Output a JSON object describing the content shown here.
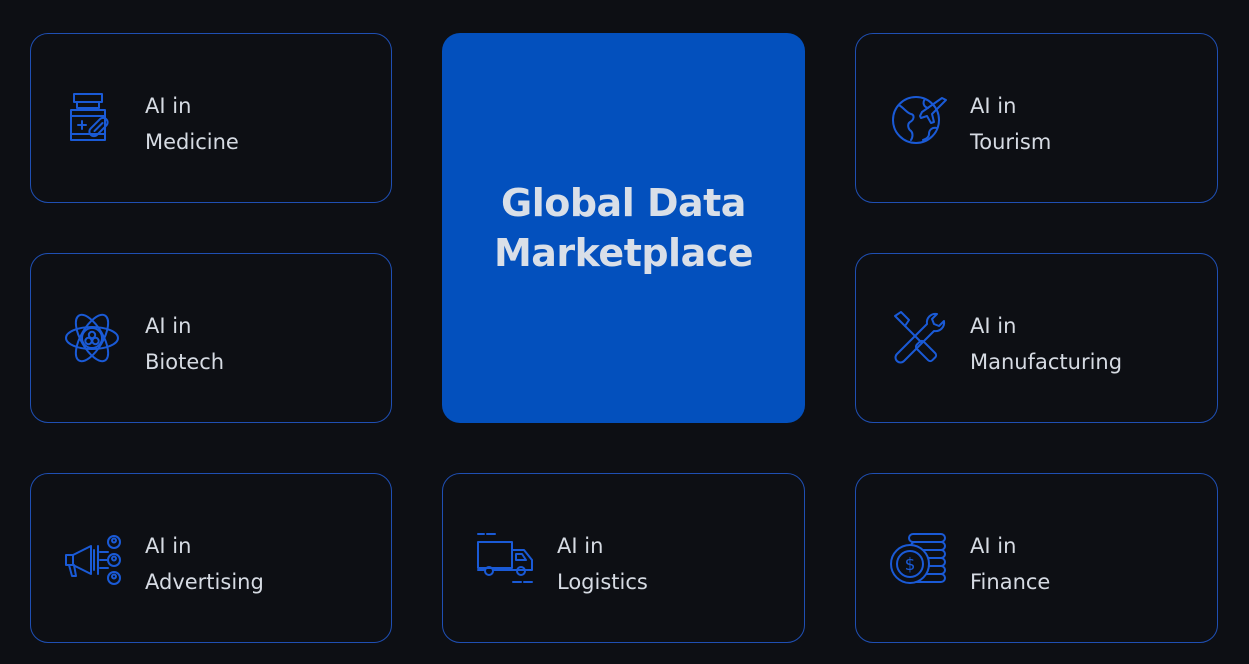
{
  "center": {
    "title_line1": "Global Data",
    "title_line2": "Marketplace",
    "color": "#0350bd"
  },
  "colors": {
    "background": "#0d0f14",
    "card_border": "#1f4fb3",
    "icon_stroke": "#1a5ad6",
    "text": "#d6dbe3"
  },
  "cards": [
    {
      "prefix": "AI in",
      "name": "Medicine",
      "icon": "medicine-icon"
    },
    {
      "prefix": "AI in",
      "name": "Tourism",
      "icon": "globe-plane-icon"
    },
    {
      "prefix": "AI in",
      "name": "Biotech",
      "icon": "atom-icon"
    },
    {
      "prefix": "AI in",
      "name": "Manufacturing",
      "icon": "tools-icon"
    },
    {
      "prefix": "AI in",
      "name": "Advertising",
      "icon": "megaphone-icon"
    },
    {
      "prefix": "AI in",
      "name": "Logistics",
      "icon": "truck-icon"
    },
    {
      "prefix": "AI in",
      "name": "Finance",
      "icon": "coins-icon"
    }
  ]
}
